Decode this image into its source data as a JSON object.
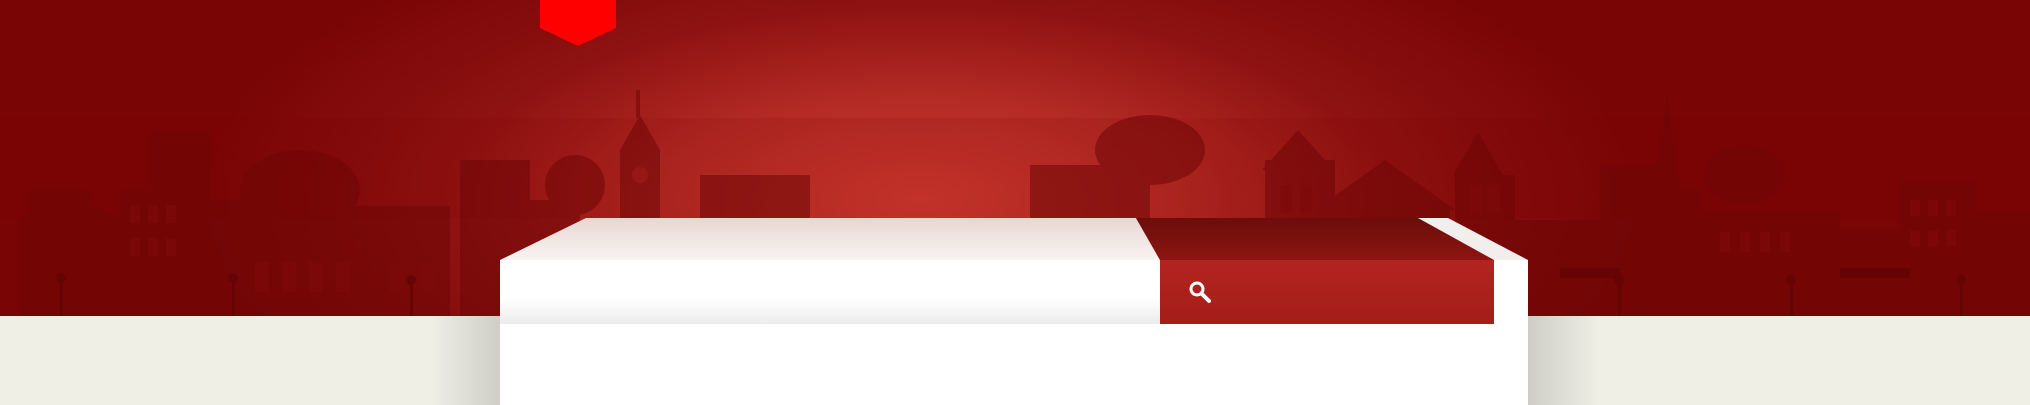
{
  "banner": {
    "colors": {
      "accent": "#7a0505",
      "glow": "#cc3a30",
      "logo": "#ff0000",
      "button": "#a51d18",
      "ground": "#efefe6"
    },
    "background": "town-skyline-silhouette"
  },
  "logo": {
    "icon": "shield-badge-icon"
  },
  "search": {
    "value": "",
    "placeholder": "",
    "button_icon": "search-icon"
  }
}
